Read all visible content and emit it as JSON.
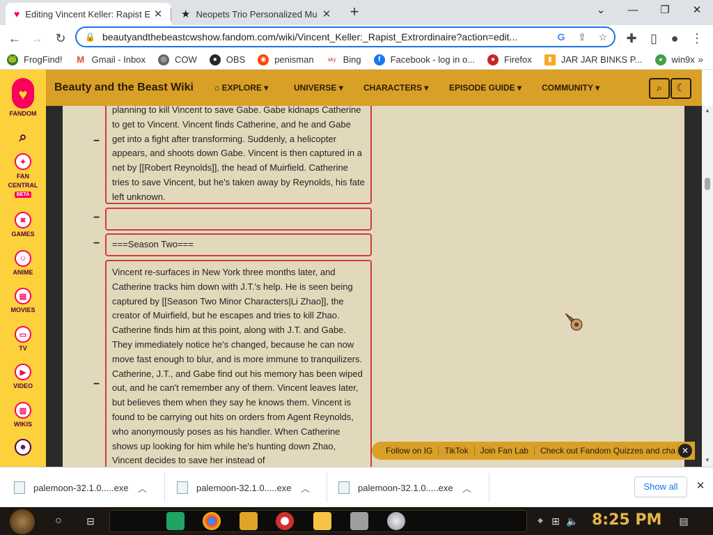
{
  "browser": {
    "tabs": [
      {
        "title": "Editing Vincent Keller: Rapist E",
        "active": true,
        "icon": "fandom-icon"
      },
      {
        "title": "Neopets Trio Personalized Mu",
        "active": false,
        "icon": "star-icon"
      }
    ],
    "url": "beautyandthebeastcwshow.fandom.com/wiki/Vincent_Keller:_Rapist_Extrordinaire?action=edit...",
    "bookmarks": [
      {
        "label": "FrogFind!",
        "icon": "frog-icon",
        "color": "#2e7d32"
      },
      {
        "label": "Gmail - Inbox",
        "icon": "gmail-icon",
        "color": "#ea4335"
      },
      {
        "label": "COW",
        "icon": "globe-icon",
        "color": "#666666"
      },
      {
        "label": "OBS",
        "icon": "github-icon",
        "color": "#24292e"
      },
      {
        "label": "penisman",
        "icon": "reddit-icon",
        "color": "#ff4500"
      },
      {
        "label": "Bing",
        "icon": "bing-icon",
        "color": "#d32f2f"
      },
      {
        "label": "Facebook - log in o...",
        "icon": "facebook-icon",
        "color": "#1877f2"
      },
      {
        "label": "Firefox",
        "icon": "firefox-icon",
        "color": "#c62828"
      },
      {
        "label": "JAR JAR BINKS P...",
        "icon": "bookmark-icon",
        "color": "#f9a825"
      },
      {
        "label": "win9x",
        "icon": "chrome-icon",
        "color": "#43a047"
      }
    ]
  },
  "fandom": {
    "logo_label": "FANDOM",
    "rail": [
      {
        "label": "FAN CENTRAL",
        "badge": "BETA",
        "icon": "rocket-icon"
      },
      {
        "label": "GAMES",
        "icon": "controller-icon"
      },
      {
        "label": "ANIME",
        "icon": "anime-icon"
      },
      {
        "label": "MOVIES",
        "icon": "movie-icon"
      },
      {
        "label": "TV",
        "icon": "tv-icon"
      },
      {
        "label": "VIDEO",
        "icon": "video-icon"
      },
      {
        "label": "WIKIS",
        "icon": "book-icon"
      }
    ],
    "wiki_name": "Beauty and the Beast Wiki",
    "nav": [
      "EXPLORE",
      "UNIVERSE",
      "CHARACTERS",
      "EPISODE GUIDE",
      "COMMUNITY"
    ],
    "brand_color": "#fa005a",
    "accent_color": "#d9a028"
  },
  "diff": {
    "blocks": [
      {
        "text": "planning to kill Vincent to save Gabe. Gabe kidnaps Catherine to get to Vincent. Vincent finds Catherine, and he and Gabe get into a fight after transforming. Suddenly, a helicopter appears, and shoots down Gabe. Vincent is then captured in a net by [[Robert Reynolds]], the head of Muirfield. Catherine tries to save Vincent, but he's taken away by Reynolds, his fate left unknown."
      },
      {
        "text": ""
      },
      {
        "text": "===Season Two==="
      },
      {
        "text": "Vincent re-surfaces in New York three months later, and Catherine tracks him down with J.T.'s help. He is seen being captured by [[Season Two Minor Characters|Li Zhao]], the creator of Muirfield, but he escapes and tries to kill Zhao. Catherine finds him at this point, along with J.T. and Gabe. They immediately notice he's changed, because he can now move fast enough to blur, and is more immune to tranquilizers. Catherine, J.T., and Gabe find out his memory has been wiped out, and he can't remember any of them. Vincent leaves later, but believes them when they say he knows them. Vincent is found to be carrying out hits on orders from Agent Reynolds, who anonymously poses as his handler. When Catherine shows up looking for him while he's hunting down Zhao, Vincent decides to save her instead of"
      }
    ],
    "marker": "−"
  },
  "social": [
    "Follow on IG",
    "TikTok",
    "Join Fan Lab",
    "Check out Fandom Quizzes and cha"
  ],
  "downloads": {
    "items": [
      "palemoon-32.1.0.....exe",
      "palemoon-32.1.0.....exe",
      "palemoon-32.1.0.....exe"
    ],
    "show_all": "Show all"
  },
  "taskbar": {
    "time": "8:25 PM"
  }
}
